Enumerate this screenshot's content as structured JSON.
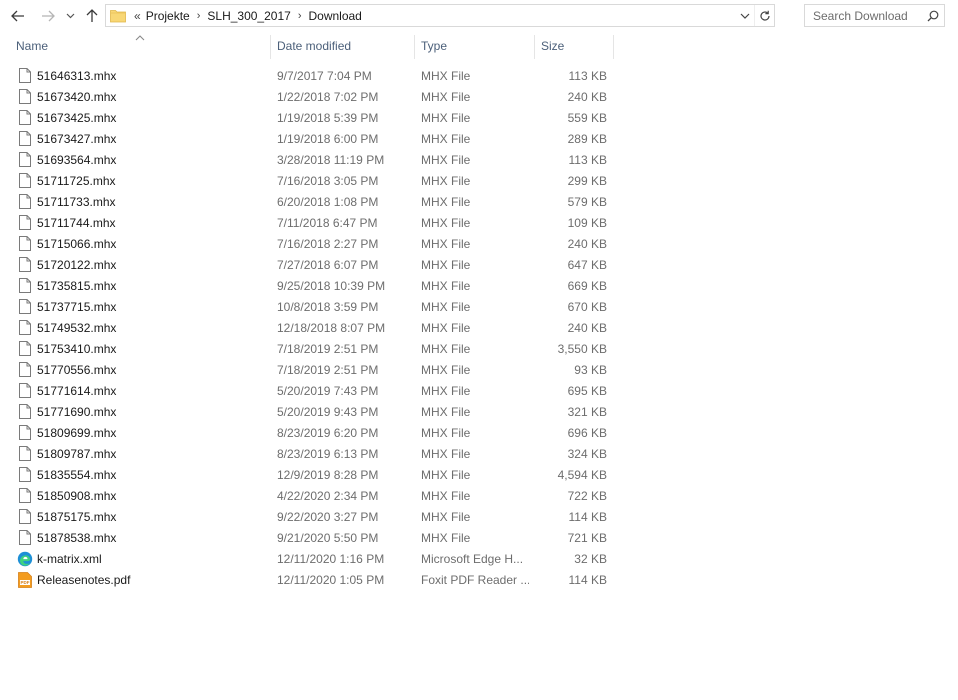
{
  "nav": {
    "back_icon": "arrow-left-icon",
    "forward_icon": "arrow-right-icon",
    "recent_icon": "chevron-down-icon",
    "up_icon": "arrow-up-icon"
  },
  "address": {
    "overflow": "«",
    "crumbs": [
      "Projekte",
      "SLH_300_2017",
      "Download"
    ]
  },
  "search": {
    "placeholder": "Search Download"
  },
  "columns": {
    "name": "Name",
    "date": "Date modified",
    "type": "Type",
    "size": "Size"
  },
  "files": [
    {
      "name": "51646313.mhx",
      "date": "9/7/2017 7:04 PM",
      "type": "MHX File",
      "size": "113 KB",
      "icon": "generic-file-icon"
    },
    {
      "name": "51673420.mhx",
      "date": "1/22/2018 7:02 PM",
      "type": "MHX File",
      "size": "240 KB",
      "icon": "generic-file-icon"
    },
    {
      "name": "51673425.mhx",
      "date": "1/19/2018 5:39 PM",
      "type": "MHX File",
      "size": "559 KB",
      "icon": "generic-file-icon"
    },
    {
      "name": "51673427.mhx",
      "date": "1/19/2018 6:00 PM",
      "type": "MHX File",
      "size": "289 KB",
      "icon": "generic-file-icon"
    },
    {
      "name": "51693564.mhx",
      "date": "3/28/2018 11:19 PM",
      "type": "MHX File",
      "size": "113 KB",
      "icon": "generic-file-icon"
    },
    {
      "name": "51711725.mhx",
      "date": "7/16/2018 3:05 PM",
      "type": "MHX File",
      "size": "299 KB",
      "icon": "generic-file-icon"
    },
    {
      "name": "51711733.mhx",
      "date": "6/20/2018 1:08 PM",
      "type": "MHX File",
      "size": "579 KB",
      "icon": "generic-file-icon"
    },
    {
      "name": "51711744.mhx",
      "date": "7/11/2018 6:47 PM",
      "type": "MHX File",
      "size": "109 KB",
      "icon": "generic-file-icon"
    },
    {
      "name": "51715066.mhx",
      "date": "7/16/2018 2:27 PM",
      "type": "MHX File",
      "size": "240 KB",
      "icon": "generic-file-icon"
    },
    {
      "name": "51720122.mhx",
      "date": "7/27/2018 6:07 PM",
      "type": "MHX File",
      "size": "647 KB",
      "icon": "generic-file-icon"
    },
    {
      "name": "51735815.mhx",
      "date": "9/25/2018 10:39 PM",
      "type": "MHX File",
      "size": "669 KB",
      "icon": "generic-file-icon"
    },
    {
      "name": "51737715.mhx",
      "date": "10/8/2018 3:59 PM",
      "type": "MHX File",
      "size": "670 KB",
      "icon": "generic-file-icon"
    },
    {
      "name": "51749532.mhx",
      "date": "12/18/2018 8:07 PM",
      "type": "MHX File",
      "size": "240 KB",
      "icon": "generic-file-icon"
    },
    {
      "name": "51753410.mhx",
      "date": "7/18/2019 2:51 PM",
      "type": "MHX File",
      "size": "3,550 KB",
      "icon": "generic-file-icon"
    },
    {
      "name": "51770556.mhx",
      "date": "7/18/2019 2:51 PM",
      "type": "MHX File",
      "size": "93 KB",
      "icon": "generic-file-icon"
    },
    {
      "name": "51771614.mhx",
      "date": "5/20/2019 7:43 PM",
      "type": "MHX File",
      "size": "695 KB",
      "icon": "generic-file-icon"
    },
    {
      "name": "51771690.mhx",
      "date": "5/20/2019 9:43 PM",
      "type": "MHX File",
      "size": "321 KB",
      "icon": "generic-file-icon"
    },
    {
      "name": "51809699.mhx",
      "date": "8/23/2019 6:20 PM",
      "type": "MHX File",
      "size": "696 KB",
      "icon": "generic-file-icon"
    },
    {
      "name": "51809787.mhx",
      "date": "8/23/2019 6:13 PM",
      "type": "MHX File",
      "size": "324 KB",
      "icon": "generic-file-icon"
    },
    {
      "name": "51835554.mhx",
      "date": "12/9/2019 8:28 PM",
      "type": "MHX File",
      "size": "4,594 KB",
      "icon": "generic-file-icon"
    },
    {
      "name": "51850908.mhx",
      "date": "4/22/2020 2:34 PM",
      "type": "MHX File",
      "size": "722 KB",
      "icon": "generic-file-icon"
    },
    {
      "name": "51875175.mhx",
      "date": "9/22/2020 3:27 PM",
      "type": "MHX File",
      "size": "114 KB",
      "icon": "generic-file-icon"
    },
    {
      "name": "51878538.mhx",
      "date": "9/21/2020 5:50 PM",
      "type": "MHX File",
      "size": "721 KB",
      "icon": "generic-file-icon"
    },
    {
      "name": "k-matrix.xml",
      "date": "12/11/2020 1:16 PM",
      "type": "Microsoft Edge H...",
      "size": "32 KB",
      "icon": "edge-icon"
    },
    {
      "name": "Releasenotes.pdf",
      "date": "12/11/2020 1:05 PM",
      "type": "Foxit PDF Reader ...",
      "size": "114 KB",
      "icon": "pdf-icon"
    }
  ],
  "colors": {
    "header_text": "#4c607a",
    "meta_text": "#6d6d6d",
    "folder": "#f8d775",
    "pdf": "#f39c1f",
    "edge": "#1e90d6"
  }
}
